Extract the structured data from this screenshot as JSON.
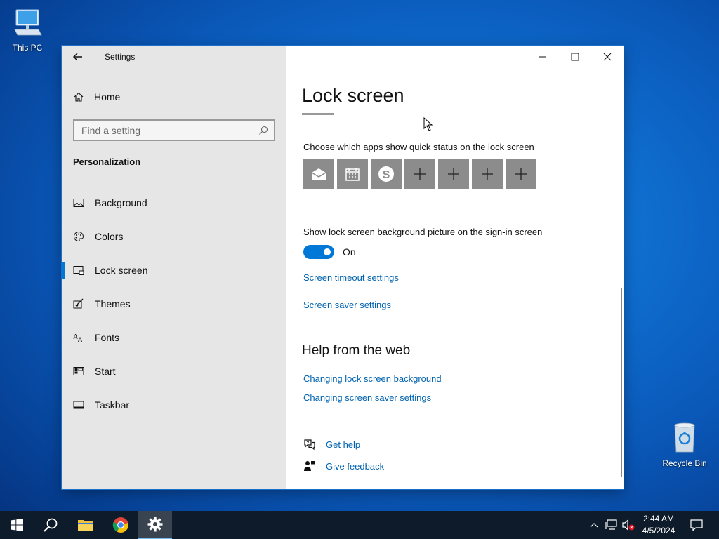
{
  "desktop": {
    "this_pc_label": "This PC",
    "recycle_bin_label": "Recycle Bin"
  },
  "window": {
    "app_title": "Settings",
    "controls": [
      "minimize",
      "maximize",
      "close"
    ]
  },
  "sidebar": {
    "home_label": "Home",
    "search_placeholder": "Find a setting",
    "section_title": "Personalization",
    "items": [
      {
        "label": "Background",
        "icon": "picture-icon",
        "active": false
      },
      {
        "label": "Colors",
        "icon": "palette-icon",
        "active": false
      },
      {
        "label": "Lock screen",
        "icon": "lock-screen-icon",
        "active": true
      },
      {
        "label": "Themes",
        "icon": "themes-icon",
        "active": false
      },
      {
        "label": "Fonts",
        "icon": "fonts-icon",
        "active": false
      },
      {
        "label": "Start",
        "icon": "start-icon",
        "active": false
      },
      {
        "label": "Taskbar",
        "icon": "taskbar-icon",
        "active": false
      }
    ]
  },
  "main": {
    "title": "Lock screen",
    "quick_status_label": "Choose which apps show quick status on the lock screen",
    "quick_status_apps": [
      "mail-icon",
      "calendar-icon",
      "skype-icon",
      "plus-icon",
      "plus-icon",
      "plus-icon",
      "plus-icon"
    ],
    "signin_bg_label": "Show lock screen background picture on the sign-in screen",
    "toggle_state": "On",
    "screen_timeout_link": "Screen timeout settings",
    "screen_saver_link": "Screen saver settings",
    "help_title": "Help from the web",
    "help_links": [
      "Changing lock screen background",
      "Changing screen saver settings"
    ],
    "get_help": "Get help",
    "give_feedback": "Give feedback"
  },
  "taskbar": {
    "time": "2:44 AM",
    "date": "4/5/2024"
  },
  "colors": {
    "accent": "#0078d7",
    "link": "#0063b1",
    "sidebar_bg": "#e6e6e6",
    "taskbar_bg": "#0e1b2a"
  }
}
